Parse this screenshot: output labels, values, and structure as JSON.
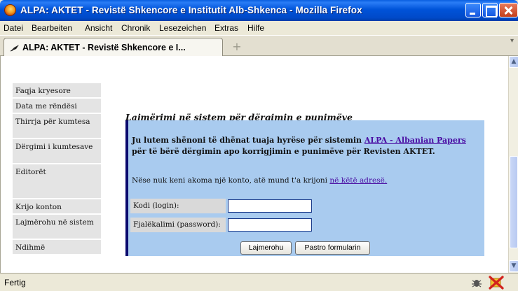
{
  "window": {
    "title": "ALPA: AKTET - Revistë Shkencore e Institutit Alb-Shkenca - Mozilla Firefox"
  },
  "menu": [
    {
      "label": "Datei"
    },
    {
      "label": "Bearbeiten"
    },
    {
      "label": "Ansicht"
    },
    {
      "label": "Chronik"
    },
    {
      "label": "Lesezeichen"
    },
    {
      "label": "Extras"
    },
    {
      "label": "Hilfe"
    }
  ],
  "tab": {
    "label": "ALPA: AKTET - Revistë Shkencore e I...",
    "new_tab_symbol": "+"
  },
  "sidebar": {
    "items": [
      {
        "label": "Faqja kryesore"
      },
      {
        "label": "Data me rëndësi"
      },
      {
        "label": "Thirrja për kumtesa"
      },
      {
        "label": "Dërgimi i kumtesave"
      },
      {
        "label": "Editorët"
      },
      {
        "label": "Krijo konton"
      },
      {
        "label": "Lajmërohu në sistem"
      },
      {
        "label": "Ndihmë"
      }
    ]
  },
  "main": {
    "heading": "Lajmërimi në sistem për dërgimin e punimëve",
    "intro_prefix": "Ju lutem shënoni të dhënat tuaja hyrëse për sistemin ",
    "intro_link": "ALPA - Albanian Papers",
    "intro_suffix": " për të bërë dërgimin apo korrigjimin e punimëve për Revisten AKTET.",
    "note_prefix": "Nëse nuk keni akoma një konto, atë mund t'a krijoni ",
    "note_link": "në këtë adresë.",
    "form": {
      "login_label": "Kodi (login):",
      "login_value": "",
      "password_label": "Fjalëkalimi (password):",
      "password_value": "",
      "submit_label": "Lajmerohu",
      "reset_label": "Pastro formularin"
    }
  },
  "status": {
    "text": "Fertig"
  },
  "colors": {
    "titlebar": "#0053D9",
    "panel": "#A9CBEF",
    "panel_border": "#0A0A6E",
    "link": "#4a0ea3",
    "sidebar_bg": "#E4E4E4"
  }
}
